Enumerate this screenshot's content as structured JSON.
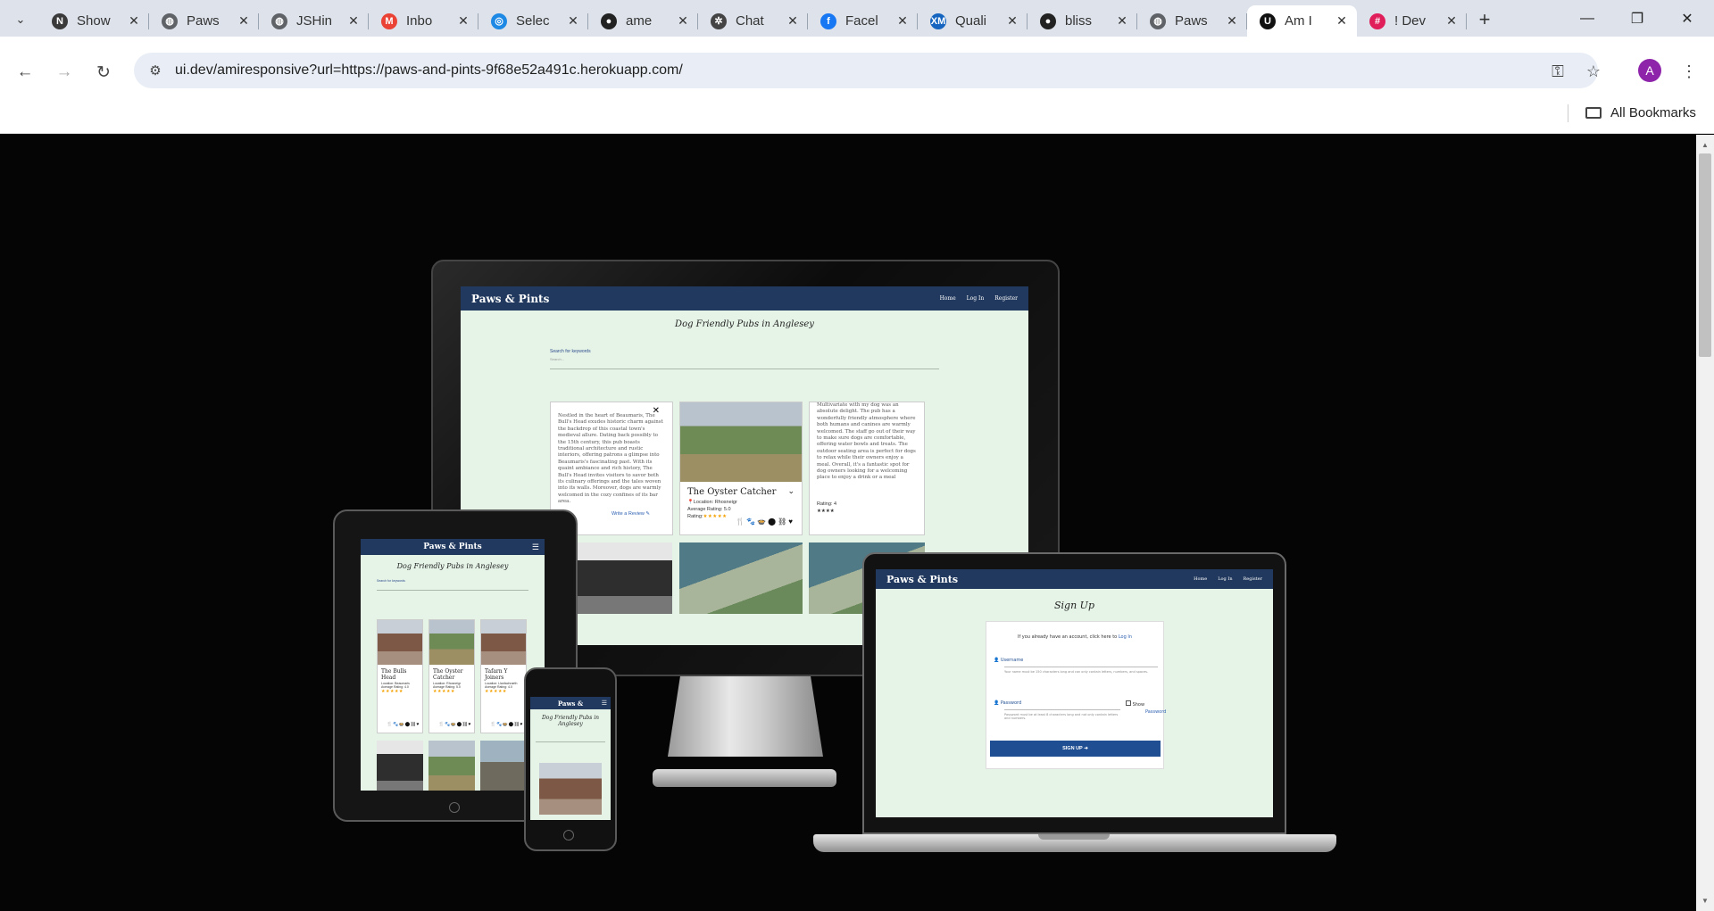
{
  "browser": {
    "tabs": [
      {
        "title": "Show",
        "favicon_icon": "showcase-icon",
        "color": "#3a3a3a",
        "glyph": "N"
      },
      {
        "title": "Paws",
        "favicon_icon": "globe-icon",
        "color": "#5f6368",
        "glyph": "◍"
      },
      {
        "title": "JSHin",
        "favicon_icon": "globe-icon",
        "color": "#5f6368",
        "glyph": "◍"
      },
      {
        "title": "Inbo",
        "favicon_icon": "gmail-icon",
        "color": "#ea4335",
        "glyph": "M"
      },
      {
        "title": "Selec",
        "favicon_icon": "edge-icon",
        "color": "#1e88e5",
        "glyph": "◎"
      },
      {
        "title": "ame",
        "favicon_icon": "github-icon",
        "color": "#222222",
        "glyph": "●"
      },
      {
        "title": "Chat",
        "favicon_icon": "chatgpt-icon",
        "color": "#444444",
        "glyph": "✲"
      },
      {
        "title": "Facel",
        "favicon_icon": "facebook-icon",
        "color": "#1877f2",
        "glyph": "f"
      },
      {
        "title": "Quali",
        "favicon_icon": "xm-icon",
        "color": "#1565c0",
        "glyph": "XM"
      },
      {
        "title": "bliss",
        "favicon_icon": "github-icon",
        "color": "#222222",
        "glyph": "●"
      },
      {
        "title": "Paws",
        "favicon_icon": "globe-icon",
        "color": "#5f6368",
        "glyph": "◍"
      },
      {
        "title": "Am I",
        "favicon_icon": "uidev-icon",
        "color": "#111111",
        "glyph": "U",
        "active": true
      },
      {
        "title": "! Dev",
        "favicon_icon": "slack-icon",
        "color": "#e01e5a",
        "glyph": "#"
      }
    ],
    "url": "ui.dev/amiresponsive?url=https://paws-and-pints-9f68e52a491c.herokuapp.com/",
    "profile_initial": "A",
    "bookmarks_label": "All Bookmarks"
  },
  "site": {
    "brand": "Paws & Pints",
    "brand_short": "Paws &",
    "nav": [
      "Home",
      "Log In",
      "Register"
    ],
    "heading": "Dog Friendly Pubs in Anglesey",
    "search_label": "Search for keywords",
    "search_placeholder": "Search...",
    "card1_text": "Nestled in the heart of Beaumaris, The Bull's Head exudes historic charm against the backdrop of this coastal town's medieval allure. Dating back possibly to the 15th century, this pub boasts traditional architecture and rustic interiors, offering patrons a glimpse into Beaumaris's fascinating past. With its quaint ambiance and rich history, The Bull's Head invites visitors to savor both its culinary offerings and the tales woven into its walls. Moreover, dogs are warmly welcomed in the cozy confines of its bar area.",
    "write_review": "Write a Review",
    "card2_title": "The Oyster Catcher",
    "card2_location": "Location: Rhosneigr",
    "card2_avg": "Average Rating: 5.0",
    "card2_rating_label": "Rating:",
    "card3_text": "Multivariate with my dog was an absolute delight. The pub has a wonderfully friendly atmosphere where both humans and canines are warmly welcomed. The staff go out of their way to make sure dogs are comfortable, offering water bowls and treats. The outdoor seating area is perfect for dogs to relax while their owners enjoy a meal. Overall, it's a fantastic spot for dog owners looking for a welcoming place to enjoy a drink or a meal",
    "card3_rating": "Rating: 4",
    "tablet_cards": [
      {
        "title": "The Bulls Head",
        "loc": "Location: Beaumaris",
        "avg": "Average Rating: 4.0"
      },
      {
        "title": "The Oyster Catcher",
        "loc": "Location: Rhosneigr",
        "avg": "Average Rating: 5.0"
      },
      {
        "title": "Tafarn Y Joiners",
        "loc": "Location: Llanfachraeth",
        "avg": "Average Rating: 4.0"
      }
    ],
    "signup_title": "Sign Up",
    "signup_prompt": "If you already have an account, click here to",
    "signup_login_link": "Log In",
    "username_label": "Username",
    "username_help": "Your name must be 150 characters long and can only contain letters, numbers, and spaces.",
    "password_label": "Password",
    "password_help": "Password must be at least 8 characters long and not only contain letters and numbers.",
    "show_label": "Show",
    "show_password": "Password",
    "signup_button": "SIGN UP",
    "stars5": "★★★★★",
    "stars4": "★★★★",
    "amenity_icons": "🍴🐾🍲⬤⛓♥"
  }
}
